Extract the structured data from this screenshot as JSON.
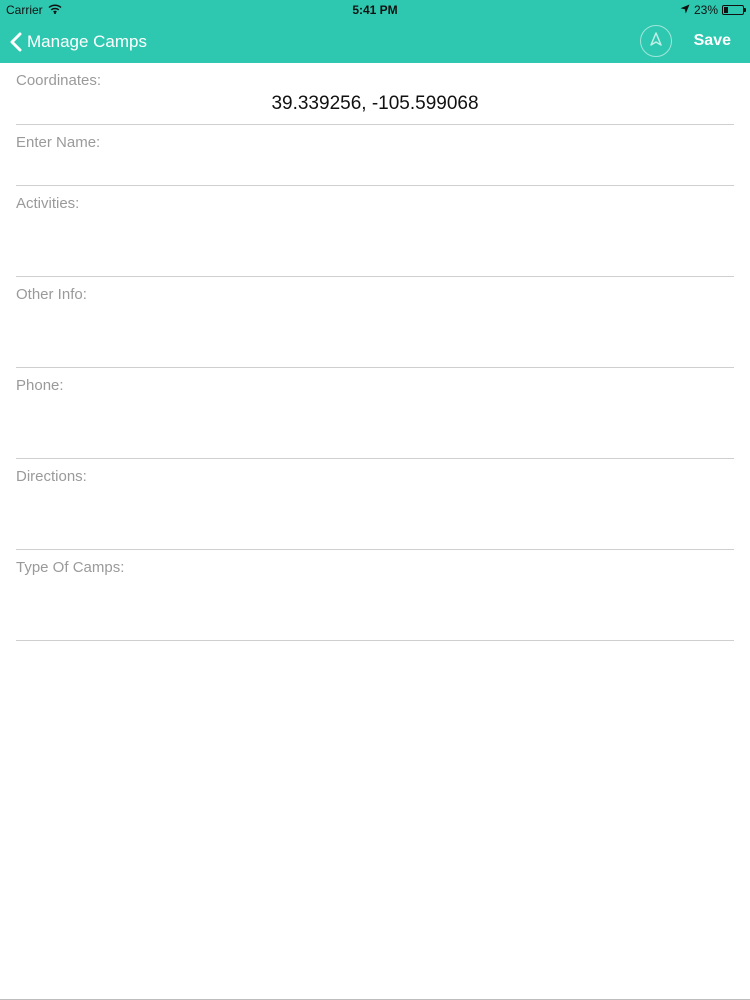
{
  "status_bar": {
    "carrier": "Carrier",
    "time": "5:41 PM",
    "battery": "23%",
    "battery_level": 0.23
  },
  "nav": {
    "back_label": "Manage Camps",
    "save_label": "Save"
  },
  "colors": {
    "accent": "#2ec8b0",
    "label": "#9a9a9a",
    "divider": "#cfcfcf"
  },
  "form": {
    "coordinates": {
      "label": "Coordinates:",
      "value": "39.339256, -105.599068"
    },
    "name": {
      "label": "Enter Name:",
      "value": ""
    },
    "activities": {
      "label": "Activities:",
      "value": ""
    },
    "other_info": {
      "label": "Other Info:",
      "value": ""
    },
    "phone": {
      "label": "Phone:",
      "value": ""
    },
    "directions": {
      "label": "Directions:",
      "value": ""
    },
    "type_of_camps": {
      "label": "Type Of Camps:",
      "value": ""
    }
  }
}
